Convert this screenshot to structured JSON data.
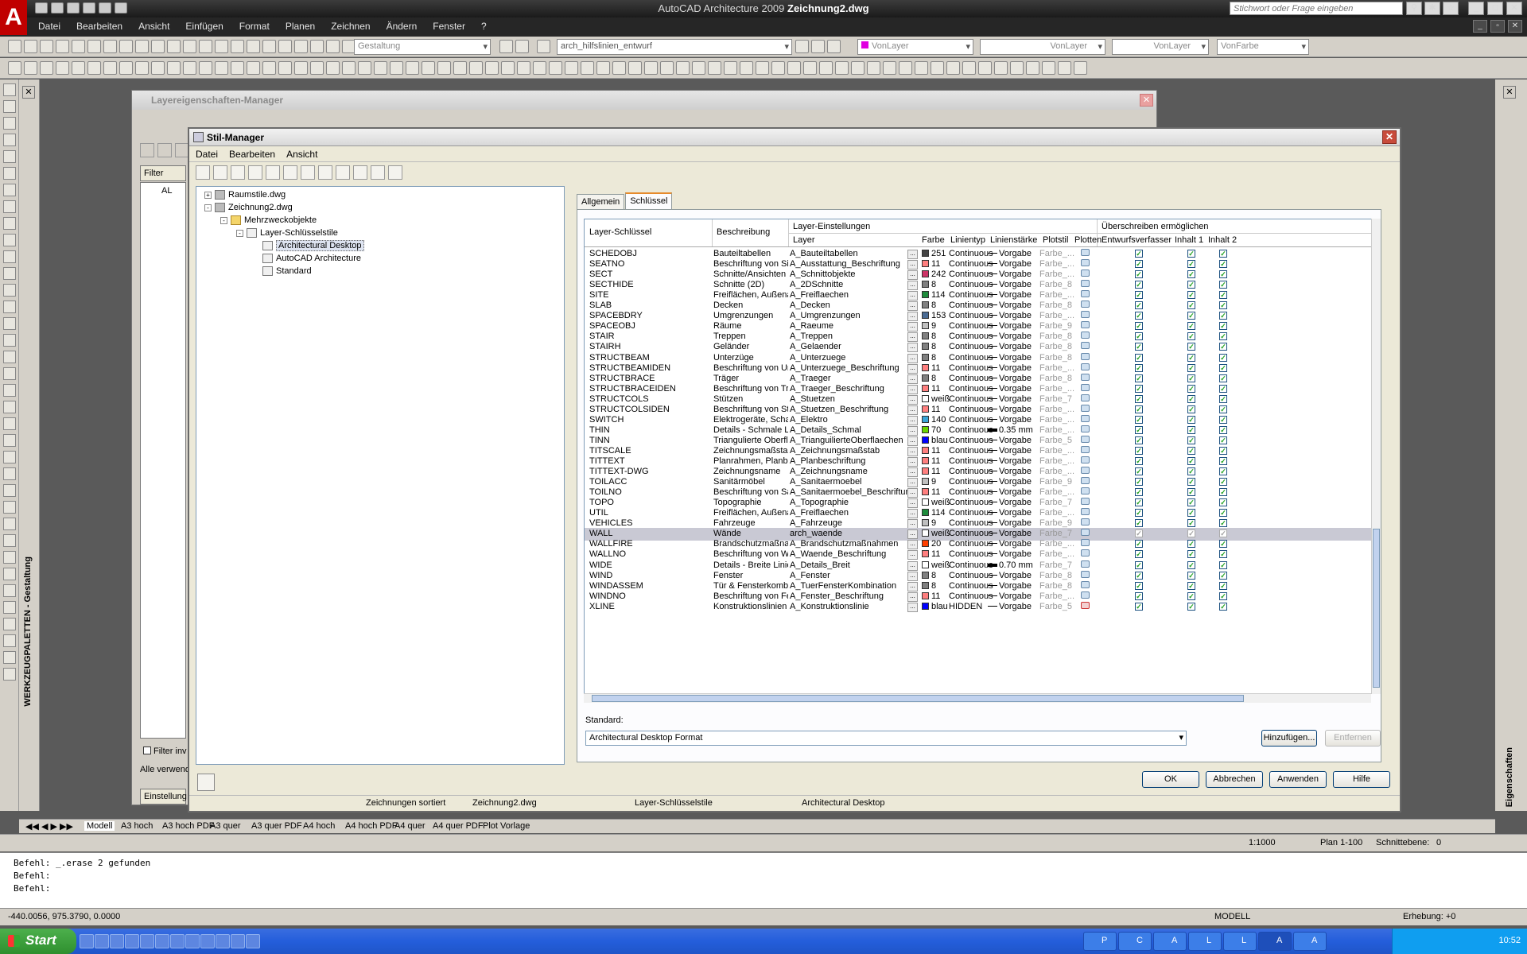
{
  "app": {
    "title_prefix": "AutoCAD Architecture 2009",
    "title_file": "Zeichnung2.dwg",
    "logo": "A",
    "search_placeholder": "Stichwort oder Frage eingeben"
  },
  "menubar": [
    "Datei",
    "Bearbeiten",
    "Ansicht",
    "Einfügen",
    "Format",
    "Planen",
    "Zeichnen",
    "Ändern",
    "Fenster",
    "?"
  ],
  "toolbar": {
    "workspace": "Gestaltung",
    "layer": "arch_hilfslinien_entwurf",
    "color": "VonLayer",
    "linetype": "VonLayer",
    "lineweight": "VonLayer",
    "plotstyle": "VonFarbe"
  },
  "layer_manager": {
    "title": "Layereigenschaften-Manager",
    "filter": "Filter",
    "tree_top": "AL",
    "filter_invert": "Filter inv",
    "all_used": "Alle verwend",
    "settings": "Einstellung"
  },
  "style_manager": {
    "title": "Stil-Manager",
    "menu": [
      "Datei",
      "Bearbeiten",
      "Ansicht"
    ],
    "tree": [
      {
        "label": "Raumstile.dwg",
        "level": 0,
        "exp": "+",
        "icon": "drawing"
      },
      {
        "label": "Zeichnung2.dwg",
        "level": 0,
        "exp": "-",
        "icon": "drawing"
      },
      {
        "label": "Mehrzweckobjekte",
        "level": 1,
        "exp": "-",
        "icon": "folder"
      },
      {
        "label": "Layer-Schlüsselstile",
        "level": 2,
        "exp": "-",
        "icon": "style"
      },
      {
        "label": "Architectural Desktop",
        "level": 3,
        "exp": "",
        "icon": "style",
        "selected": true
      },
      {
        "label": "AutoCAD Architecture",
        "level": 3,
        "exp": "",
        "icon": "style"
      },
      {
        "label": "Standard",
        "level": 3,
        "exp": "",
        "icon": "style"
      }
    ],
    "tabs": [
      "Allgemein",
      "Schlüssel"
    ],
    "active_tab": "Schlüssel",
    "headers": {
      "key": "Layer-Schlüssel",
      "desc": "Beschreibung",
      "layer_settings": "Layer-Einstellungen",
      "layer": "Layer",
      "color": "Farbe",
      "linetype": "Linientyp",
      "lineweight": "Linienstärke",
      "plotstyle": "Plotstil",
      "plot": "Plotten",
      "override": "Überschreiben ermöglichen",
      "author": "Entwurfsverfasser",
      "content1": "Inhalt 1",
      "content2": "Inhalt 2"
    },
    "rows": [
      {
        "key": "SCHEDOBJ",
        "desc": "Bauteiltabellen",
        "layer": "A_Bauteiltabellen",
        "color": "251",
        "hex": "#444444",
        "lt": "Continuous",
        "lw": "Vorgabe",
        "ps": "Farbe_..."
      },
      {
        "key": "SEATNO",
        "desc": "Beschriftung von Sitz...",
        "layer": "A_Ausstattung_Beschriftung",
        "color": "11",
        "hex": "#ff7f7f",
        "lt": "Continuous",
        "lw": "Vorgabe",
        "ps": "Farbe_..."
      },
      {
        "key": "SECT",
        "desc": "Schnitte/Ansichten",
        "layer": "A_Schnittobjekte",
        "color": "242",
        "hex": "#cc3366",
        "lt": "Continuous",
        "lw": "Vorgabe",
        "ps": "Farbe_..."
      },
      {
        "key": "SECTHIDE",
        "desc": "Schnitte (2D)",
        "layer": "A_2DSchnitte",
        "color": "8",
        "hex": "#808080",
        "lt": "Continuous",
        "lw": "Vorgabe",
        "ps": "Farbe_8"
      },
      {
        "key": "SITE",
        "desc": "Freiflächen, Außenanl...",
        "layer": "A_Freiflaechen",
        "color": "114",
        "hex": "#1e8c3c",
        "lt": "Continuous",
        "lw": "Vorgabe",
        "ps": "Farbe_..."
      },
      {
        "key": "SLAB",
        "desc": "Decken",
        "layer": "A_Decken",
        "color": "8",
        "hex": "#808080",
        "lt": "Continuous",
        "lw": "Vorgabe",
        "ps": "Farbe_8"
      },
      {
        "key": "SPACEBDRY",
        "desc": "Umgrenzungen",
        "layer": "A_Umgrenzungen",
        "color": "153",
        "hex": "#4a6b94",
        "lt": "Continuous",
        "lw": "Vorgabe",
        "ps": "Farbe_..."
      },
      {
        "key": "SPACEOBJ",
        "desc": "Räume",
        "layer": "A_Raeume",
        "color": "9",
        "hex": "#c0c0c0",
        "lt": "Continuous",
        "lw": "Vorgabe",
        "ps": "Farbe_9"
      },
      {
        "key": "STAIR",
        "desc": "Treppen",
        "layer": "A_Treppen",
        "color": "8",
        "hex": "#808080",
        "lt": "Continuous",
        "lw": "Vorgabe",
        "ps": "Farbe_8"
      },
      {
        "key": "STAIRH",
        "desc": "Geländer",
        "layer": "A_Gelaender",
        "color": "8",
        "hex": "#808080",
        "lt": "Continuous",
        "lw": "Vorgabe",
        "ps": "Farbe_8"
      },
      {
        "key": "STRUCTBEAM",
        "desc": "Unterzüge",
        "layer": "A_Unterzuege",
        "color": "8",
        "hex": "#808080",
        "lt": "Continuous",
        "lw": "Vorgabe",
        "ps": "Farbe_8"
      },
      {
        "key": "STRUCTBEAMIDEN",
        "desc": "Beschriftung von Unte...",
        "layer": "A_Unterzuege_Beschriftung",
        "color": "11",
        "hex": "#ff7f7f",
        "lt": "Continuous",
        "lw": "Vorgabe",
        "ps": "Farbe_..."
      },
      {
        "key": "STRUCTBRACE",
        "desc": "Träger",
        "layer": "A_Traeger",
        "color": "8",
        "hex": "#808080",
        "lt": "Continuous",
        "lw": "Vorgabe",
        "ps": "Farbe_8"
      },
      {
        "key": "STRUCTBRACEIDEN",
        "desc": "Beschriftung von Träg...",
        "layer": "A_Traeger_Beschriftung",
        "color": "11",
        "hex": "#ff7f7f",
        "lt": "Continuous",
        "lw": "Vorgabe",
        "ps": "Farbe_..."
      },
      {
        "key": "STRUCTCOLS",
        "desc": "Stützen",
        "layer": "A_Stuetzen",
        "color": "weiß",
        "hex": "#ffffff",
        "lt": "Continuous",
        "lw": "Vorgabe",
        "ps": "Farbe_7"
      },
      {
        "key": "STRUCTCOLSIDEN",
        "desc": "Beschriftung von Stüt...",
        "layer": "A_Stuetzen_Beschriftung",
        "color": "11",
        "hex": "#ff7f7f",
        "lt": "Continuous",
        "lw": "Vorgabe",
        "ps": "Farbe_..."
      },
      {
        "key": "SWITCH",
        "desc": "Elektrogeräte, Schalter",
        "layer": "A_Elektro",
        "color": "140",
        "hex": "#3ba5d6",
        "lt": "Continuous",
        "lw": "Vorgabe",
        "ps": "Farbe_..."
      },
      {
        "key": "THIN",
        "desc": "Details - Schmale Linien",
        "layer": "A_Details_Schmal",
        "color": "70",
        "hex": "#6ad400",
        "lt": "Continuous",
        "lw": "0.35 mm",
        "ps": "Farbe_..."
      },
      {
        "key": "TINN",
        "desc": "Triangulierte Oberfläc...",
        "layer": "A_TrianguilierteOberflaechen",
        "color": "blau",
        "hex": "#0000ff",
        "lt": "Continuous",
        "lw": "Vorgabe",
        "ps": "Farbe_5"
      },
      {
        "key": "TITSCALE",
        "desc": "Zeichnungsmaßstab",
        "layer": "A_Zeichnungsmaßstab",
        "color": "11",
        "hex": "#ff7f7f",
        "lt": "Continuous",
        "lw": "Vorgabe",
        "ps": "Farbe_..."
      },
      {
        "key": "TITTEXT",
        "desc": "Planrahmen, Planbesc...",
        "layer": "A_Planbeschriftung",
        "color": "11",
        "hex": "#ff7f7f",
        "lt": "Continuous",
        "lw": "Vorgabe",
        "ps": "Farbe_..."
      },
      {
        "key": "TITTEXT-DWG",
        "desc": "Zeichnungsname",
        "layer": "A_Zeichnungsname",
        "color": "11",
        "hex": "#ff7f7f",
        "lt": "Continuous",
        "lw": "Vorgabe",
        "ps": "Farbe_..."
      },
      {
        "key": "TOILACC",
        "desc": "Sanitärmöbel",
        "layer": "A_Sanitaermoebel",
        "color": "9",
        "hex": "#c0c0c0",
        "lt": "Continuous",
        "lw": "Vorgabe",
        "ps": "Farbe_9"
      },
      {
        "key": "TOILNO",
        "desc": "Beschriftung von Sani...",
        "layer": "A_Sanitaermoebel_Beschriftung",
        "color": "11",
        "hex": "#ff7f7f",
        "lt": "Continuous",
        "lw": "Vorgabe",
        "ps": "Farbe_..."
      },
      {
        "key": "TOPO",
        "desc": "Topographie",
        "layer": "A_Topographie",
        "color": "weiß",
        "hex": "#ffffff",
        "lt": "Continuous",
        "lw": "Vorgabe",
        "ps": "Farbe_7"
      },
      {
        "key": "UTIL",
        "desc": "Freiflächen, Außenanl...",
        "layer": "A_Freiflaechen",
        "color": "114",
        "hex": "#1e8c3c",
        "lt": "Continuous",
        "lw": "Vorgabe",
        "ps": "Farbe_..."
      },
      {
        "key": "VEHICLES",
        "desc": "Fahrzeuge",
        "layer": "A_Fahrzeuge",
        "color": "9",
        "hex": "#c0c0c0",
        "lt": "Continuous",
        "lw": "Vorgabe",
        "ps": "Farbe_9"
      },
      {
        "key": "WALL",
        "desc": "Wände",
        "layer": "arch_waende",
        "color": "weiß",
        "hex": "#ffffff",
        "lt": "Continuous",
        "lw": "Vorgabe",
        "ps": "Farbe_7",
        "selected": true
      },
      {
        "key": "WALLFIRE",
        "desc": "Brandschutzmaßnahm...",
        "layer": "A_Brandschutzmaßnahmen",
        "color": "20",
        "hex": "#ff3f00",
        "lt": "Continuous",
        "lw": "Vorgabe",
        "ps": "Farbe_..."
      },
      {
        "key": "WALLNO",
        "desc": "Beschriftung von Wän...",
        "layer": "A_Waende_Beschriftung",
        "color": "11",
        "hex": "#ff7f7f",
        "lt": "Continuous",
        "lw": "Vorgabe",
        "ps": "Farbe_..."
      },
      {
        "key": "WIDE",
        "desc": "Details - Breite Linien",
        "layer": "A_Details_Breit",
        "color": "weiß",
        "hex": "#ffffff",
        "lt": "Continuous",
        "lw": "0.70 mm",
        "ps": "Farbe_7"
      },
      {
        "key": "WIND",
        "desc": "Fenster",
        "layer": "A_Fenster",
        "color": "8",
        "hex": "#808080",
        "lt": "Continuous",
        "lw": "Vorgabe",
        "ps": "Farbe_8"
      },
      {
        "key": "WINDASSEM",
        "desc": "Tür & Fensterkombinat...",
        "layer": "A_TuerFensterKombination",
        "color": "8",
        "hex": "#808080",
        "lt": "Continuous",
        "lw": "Vorgabe",
        "ps": "Farbe_8"
      },
      {
        "key": "WINDNO",
        "desc": "Beschriftung von Fens...",
        "layer": "A_Fenster_Beschriftung",
        "color": "11",
        "hex": "#ff7f7f",
        "lt": "Continuous",
        "lw": "Vorgabe",
        "ps": "Farbe_..."
      },
      {
        "key": "XLINE",
        "desc": "Konstruktionslinien",
        "layer": "A_Konstruktionslinie",
        "color": "blau",
        "hex": "#0000ff",
        "lt": "HIDDEN",
        "lw": "Vorgabe",
        "ps": "Farbe_5",
        "noplot": true
      }
    ],
    "standard_label": "Standard:",
    "standard_value": "Architectural Desktop Format",
    "buttons": {
      "add": "Hinzufügen...",
      "remove": "Entfernen",
      "ok": "OK",
      "cancel": "Abbrechen",
      "apply": "Anwenden",
      "help": "Hilfe"
    },
    "status": [
      "Zeichnungen sortiert",
      "Zeichnung2.dwg",
      "Layer-Schlüsselstile",
      "Architectural Desktop"
    ]
  },
  "palette_label": "WERKZEUGPALETTEN - Gestaltung",
  "properties_label": "Eigenschaften",
  "layout_tabs": [
    "Modell",
    "A3 hoch",
    "A3 hoch PDF",
    "A3 quer",
    "A3 quer PDF",
    "A4 hoch",
    "A4 hoch PDF",
    "A4 quer",
    "A4 quer PDF",
    "Plot Vorlage"
  ],
  "scale": {
    "scale": "1:1000",
    "plan": "Plan 1-100",
    "cut_label": "Schnittebene:",
    "cut_value": "0"
  },
  "command_lines": [
    "Befehl: _.erase 2 gefunden",
    "Befehl:",
    "Befehl:"
  ],
  "statusbar": {
    "coords": "-440.0056, 975.3790, 0.0000",
    "model": "MODELL",
    "elevation": "Erhebung: +0"
  },
  "taskbar": {
    "start": "Start",
    "tasks": [
      "P",
      "C",
      "A",
      "L",
      "L",
      "A",
      "A"
    ],
    "clock": "10:52"
  },
  "colors": {
    "accent": "#e68b2c",
    "titlebar": "#1a1a1a",
    "dialog": "#ece9d8",
    "selection": "#c9c9d4"
  }
}
